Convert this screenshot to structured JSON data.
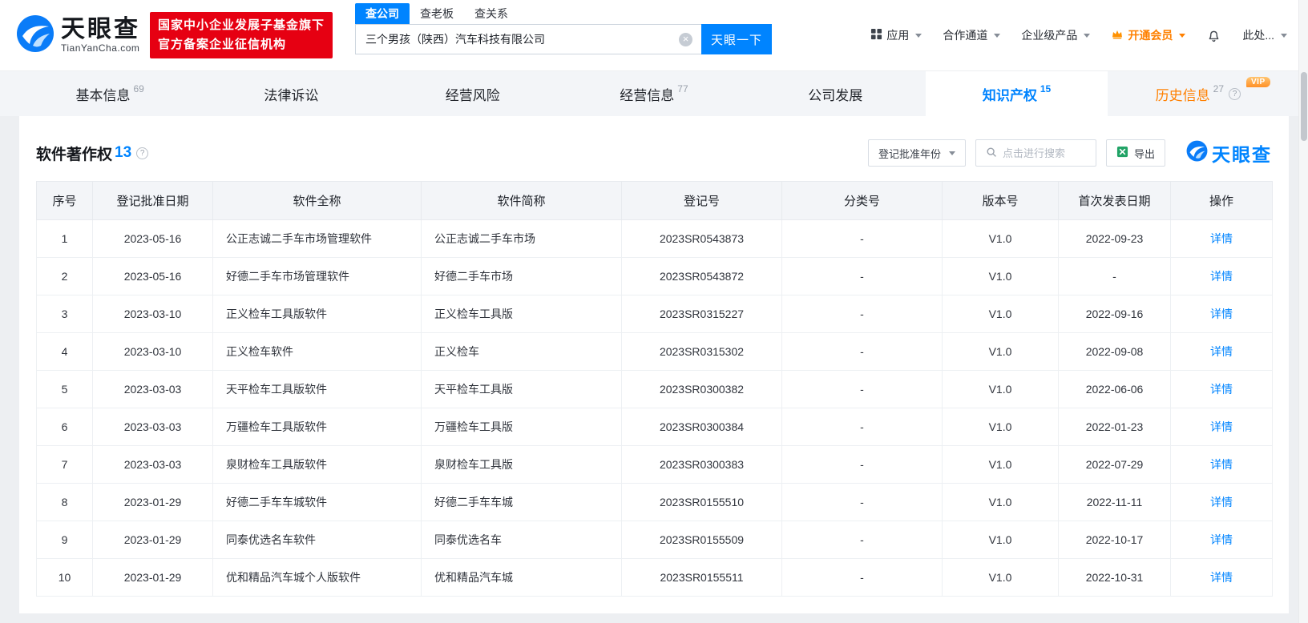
{
  "brand": {
    "name": "天眼查",
    "domain": "TianYanCha.com",
    "badge_line1": "国家中小企业发展子基金旗下",
    "badge_line2": "官方备案企业征信机构",
    "colors": {
      "primary": "#0084ff",
      "badge_red": "#e60012",
      "vip_orange": "#ff8000",
      "link_blue": "#0084ff",
      "excel_green": "#21a366"
    }
  },
  "search": {
    "tabs": [
      {
        "label": "查公司",
        "active": true
      },
      {
        "label": "查老板",
        "active": false
      },
      {
        "label": "查关系",
        "active": false
      }
    ],
    "value": "三个男孩（陕西）汽车科技有限公司",
    "clear_icon": "×",
    "button_label": "天眼一下"
  },
  "nav": {
    "apps": "应用",
    "cooperation": "合作通道",
    "enterprise": "企业级产品",
    "vip": "开通会员",
    "user": "此处..."
  },
  "company_tabs": [
    {
      "label": "基本信息",
      "count": "69",
      "active": false
    },
    {
      "label": "法律诉讼",
      "count": "",
      "active": false
    },
    {
      "label": "经营风险",
      "count": "",
      "active": false
    },
    {
      "label": "经营信息",
      "count": "77",
      "active": false
    },
    {
      "label": "公司发展",
      "count": "",
      "active": false
    },
    {
      "label": "知识产权",
      "count": "15",
      "active": true
    },
    {
      "label": "历史信息",
      "count": "27",
      "active": false,
      "vip_badge": "VIP",
      "help": "?"
    }
  ],
  "section": {
    "title": "软件著作权",
    "count": "13",
    "help": "?",
    "year_filter_label": "登记批准年份",
    "search_placeholder": "点击进行搜索",
    "export_label": "导出",
    "watermark": "天眼查"
  },
  "table": {
    "headers": [
      "序号",
      "登记批准日期",
      "软件全称",
      "软件简称",
      "登记号",
      "分类号",
      "版本号",
      "首次发表日期",
      "操作"
    ],
    "action_label": "详情",
    "rows": [
      {
        "no": "1",
        "date": "2023-05-16",
        "full_name": "公正志诚二手车市场管理软件",
        "short_name": "公正志诚二手车市场",
        "reg_no": "2023SR0543873",
        "class_no": "-",
        "version": "V1.0",
        "pub_date": "2022-09-23"
      },
      {
        "no": "2",
        "date": "2023-05-16",
        "full_name": "好德二手车市场管理软件",
        "short_name": "好德二手车市场",
        "reg_no": "2023SR0543872",
        "class_no": "-",
        "version": "V1.0",
        "pub_date": "-"
      },
      {
        "no": "3",
        "date": "2023-03-10",
        "full_name": "正义检车工具版软件",
        "short_name": "正义检车工具版",
        "reg_no": "2023SR0315227",
        "class_no": "-",
        "version": "V1.0",
        "pub_date": "2022-09-16"
      },
      {
        "no": "4",
        "date": "2023-03-10",
        "full_name": "正义检车软件",
        "short_name": "正义检车",
        "reg_no": "2023SR0315302",
        "class_no": "-",
        "version": "V1.0",
        "pub_date": "2022-09-08"
      },
      {
        "no": "5",
        "date": "2023-03-03",
        "full_name": "天平检车工具版软件",
        "short_name": "天平检车工具版",
        "reg_no": "2023SR0300382",
        "class_no": "-",
        "version": "V1.0",
        "pub_date": "2022-06-06"
      },
      {
        "no": "6",
        "date": "2023-03-03",
        "full_name": "万疆检车工具版软件",
        "short_name": "万疆检车工具版",
        "reg_no": "2023SR0300384",
        "class_no": "-",
        "version": "V1.0",
        "pub_date": "2022-01-23"
      },
      {
        "no": "7",
        "date": "2023-03-03",
        "full_name": "泉财检车工具版软件",
        "short_name": "泉财检车工具版",
        "reg_no": "2023SR0300383",
        "class_no": "-",
        "version": "V1.0",
        "pub_date": "2022-07-29"
      },
      {
        "no": "8",
        "date": "2023-01-29",
        "full_name": "好德二手车车城软件",
        "short_name": "好德二手车车城",
        "reg_no": "2023SR0155510",
        "class_no": "-",
        "version": "V1.0",
        "pub_date": "2022-11-11"
      },
      {
        "no": "9",
        "date": "2023-01-29",
        "full_name": "同泰优选名车软件",
        "short_name": "同泰优选名车",
        "reg_no": "2023SR0155509",
        "class_no": "-",
        "version": "V1.0",
        "pub_date": "2022-10-17"
      },
      {
        "no": "10",
        "date": "2023-01-29",
        "full_name": "优和精品汽车城个人版软件",
        "short_name": "优和精品汽车城",
        "reg_no": "2023SR0155511",
        "class_no": "-",
        "version": "V1.0",
        "pub_date": "2022-10-31"
      }
    ]
  }
}
